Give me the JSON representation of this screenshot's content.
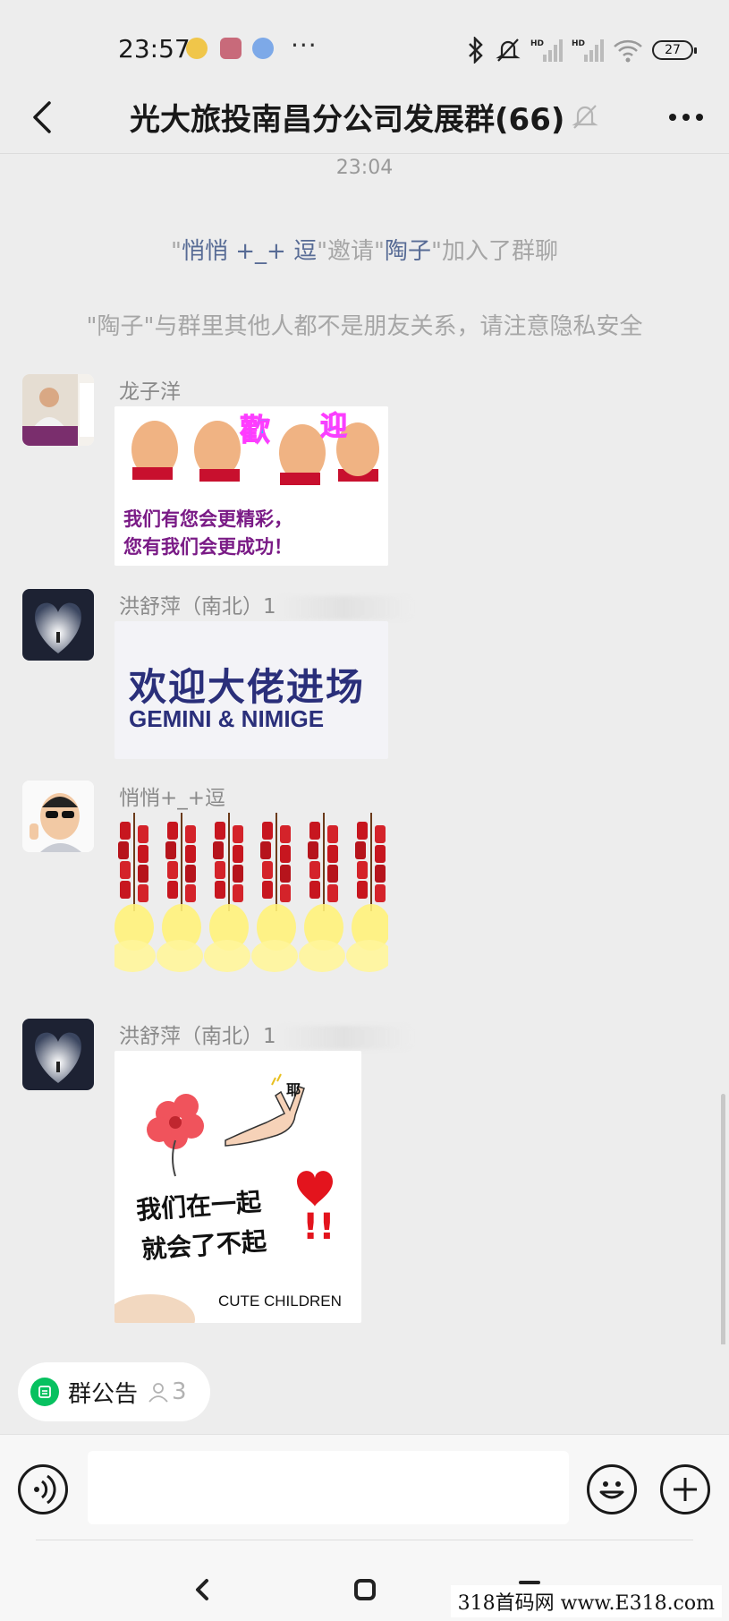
{
  "status_bar": {
    "time": "23:57",
    "app_icons": [
      "app-icon-1",
      "app-icon-2",
      "app-icon-3"
    ],
    "more": "···",
    "battery": "27"
  },
  "header": {
    "title": "光大旅投南昌分公司发展群(66)",
    "back_icon": "back-arrow-icon",
    "mute_icon": "mute-bell-icon",
    "more_icon": "more-dots-icon"
  },
  "chat": {
    "timestamp": "23:04",
    "system_messages": [
      {
        "q1": "\"",
        "name1": "悄悄 +_+ 逗",
        "mid": "\"邀请\"",
        "name2": "陶子",
        "tail": "\"加入了群聊"
      },
      {
        "text": "\"陶子\"与群里其他人都不是朋友关系，请注意隐私安全"
      }
    ],
    "messages": [
      {
        "sender": "龙子洋",
        "sticker_text": [
          "我们有您会更精彩，",
          "您有我们会更成功！"
        ],
        "sticker_title": "歡  迎"
      },
      {
        "sender": "洪舒萍（南北）1",
        "sticker_text": [
          "欢迎大佬进场",
          "GEMINI & NIMIGE"
        ]
      },
      {
        "sender": "悄悄+_+逗",
        "sticker_desc": "firecrackers"
      },
      {
        "sender": "洪舒萍（南北）1",
        "sticker_text": [
          "我们在一起",
          "就会了不起",
          "CUTE CHILDREN",
          "耶"
        ]
      }
    ]
  },
  "announcement": {
    "label": "群公告",
    "count": "3"
  },
  "input_bar": {
    "placeholder": "",
    "voice_icon": "voice-icon",
    "emoji_icon": "emoji-icon",
    "plus_icon": "plus-icon"
  },
  "system_nav": {
    "back": "nav-back-icon",
    "home": "nav-home-icon",
    "menu": "nav-menu-icon"
  },
  "watermark": "318首码网 www.E318.com",
  "colors": {
    "background": "#ededed",
    "link_blue": "#576b95",
    "wechat_green": "#07c160"
  }
}
